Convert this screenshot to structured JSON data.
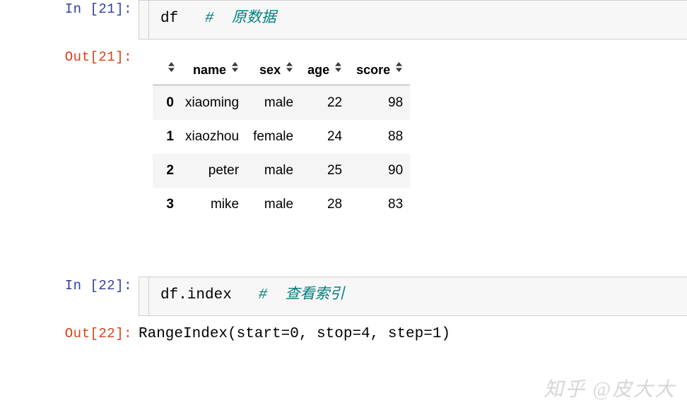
{
  "colors": {
    "in_prompt": "#303f9f",
    "out_prompt": "#d84315",
    "comment": "#007f7f",
    "cell_background": "#f7f7f7",
    "cell_border": "#cfcfcf",
    "row_stripe": "#f5f5f5",
    "header_rule": "#d9d9d9",
    "watermark": "#d6d6d6"
  },
  "cells": [
    {
      "in_prompt": "In [21]:",
      "out_prompt": "Out[21]:",
      "code": "df",
      "comment": "#  原数据"
    },
    {
      "in_prompt": "In [22]:",
      "out_prompt": "Out[22]:",
      "code": "df.index",
      "comment": "#  查看索引",
      "output_text": "RangeIndex(start=0, stop=4, step=1)"
    }
  ],
  "dataframe": {
    "index_header": "",
    "columns": [
      "name",
      "sex",
      "age",
      "score"
    ],
    "index": [
      "0",
      "1",
      "2",
      "3"
    ],
    "rows": [
      [
        "xiaoming",
        "male",
        "22",
        "98"
      ],
      [
        "xiaozhou",
        "female",
        "24",
        "88"
      ],
      [
        "peter",
        "male",
        "25",
        "90"
      ],
      [
        "mike",
        "male",
        "28",
        "83"
      ]
    ],
    "sort_icon": "sort-updown-icon"
  },
  "watermark": {
    "text": "知乎 @皮大大"
  }
}
